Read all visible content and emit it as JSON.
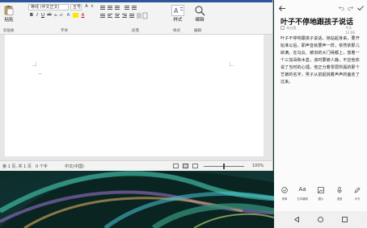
{
  "word": {
    "font_name": "等线 (中文正文)",
    "font_size": "五号",
    "groups": [
      "剪贴板",
      "字体",
      "段落",
      "样式",
      "编辑"
    ],
    "paste_label": "粘贴",
    "styles_label": "样式",
    "edit_label": "编辑",
    "status": {
      "page": "第 1 页, 共 1 页",
      "words": "0 个字",
      "language": "中文(中国)",
      "zoom": "100%"
    }
  },
  "note": {
    "title": "叶子不停地跟孩子说话",
    "category": "未分类",
    "time": "今天 12:08",
    "body": "叶子不停地跟孩子说话，她站起身来，要开始准以后，即声音就要声一样，依然依那儿欲满。在乌云、被旧的大门得都上，放着一个三加哥和木盒，该时要被人静，不应他依说了当时的心理。他正分着零层所属的那个艺被的名字，男子从前起挑着声声的面走了过来。",
    "tools": [
      "清单",
      "文本编辑",
      "图片",
      "语音",
      "手写"
    ]
  },
  "icons": {
    "back": "arrow-left-icon",
    "undo": "undo-icon",
    "redo": "redo-icon",
    "done": "check-icon"
  }
}
